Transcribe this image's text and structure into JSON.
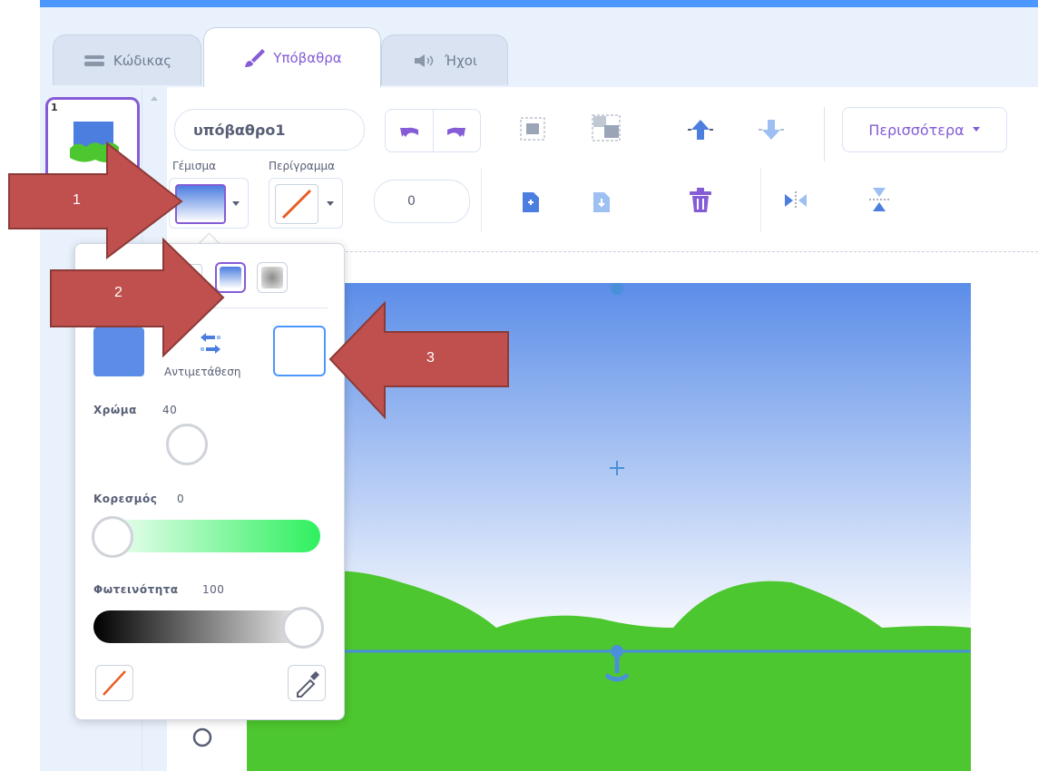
{
  "tabs": [
    {
      "label": "Κώδικας",
      "icon": "code-icon"
    },
    {
      "label": "Υπόβαθρα",
      "icon": "brush-icon"
    },
    {
      "label": "Ήχοι",
      "icon": "speaker-icon"
    }
  ],
  "backdrop_list": {
    "items": [
      {
        "number": "1"
      }
    ]
  },
  "toolbar": {
    "costume_name": "υπόβαθρο1",
    "fill_label": "Γέμισμα",
    "outline_label": "Περίγραμμα",
    "outline_width": "0",
    "more_label": "Περισσότερα"
  },
  "color_picker": {
    "swap_label": "Αντιμετάθεση",
    "color_label": "Χρώμα",
    "color_value": "40",
    "saturation_label": "Κορεσμός",
    "saturation_value": "0",
    "brightness_label": "Φωτεινότητα",
    "brightness_value": "100",
    "primary_color": "#5b8de8",
    "secondary_color": "#ffffff"
  },
  "annotations": [
    {
      "number": "1"
    },
    {
      "number": "2"
    },
    {
      "number": "3"
    }
  ],
  "colors": {
    "accent": "#855cd6",
    "sky_top": "#5b8de8",
    "grass": "#4dc72f",
    "arrow": "#b94a48"
  }
}
